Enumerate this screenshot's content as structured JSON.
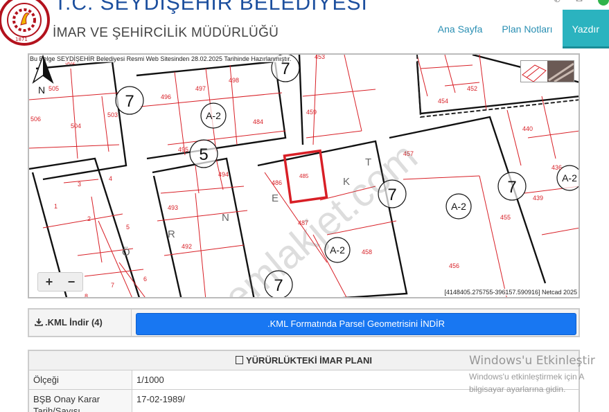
{
  "header": {
    "title": "T.C. SEYDİŞEHİR BELEDİYESİ",
    "subtitle": "İMAR VE ŞEHİRCİLİK MÜDÜRLÜĞÜ",
    "logo_year": "1871"
  },
  "nav": {
    "items": [
      {
        "label": "Ana Sayfa"
      },
      {
        "label": "Plan Notları"
      },
      {
        "label": "Yazdır"
      }
    ],
    "active_index": 2,
    "accent_color": "#2bb3bf",
    "link_color": "#2a8fb3"
  },
  "map": {
    "caption": "Bu Belge SEYDİŞEHİR Belediyesi Resmi Web Sitesinden 28.02.2025 Tarihinde Hazırlanmıştır.",
    "coords": "[4148405.275755-396157.590916] Netcad 2025",
    "zoom_in": "+",
    "zoom_out": "−",
    "north_label": "N",
    "selected_parcel": "485",
    "parcel_line_color": "#d81f26",
    "watermark": "emlakjet.com",
    "parcels": [
      "502",
      "505",
      "496",
      "497",
      "498",
      "453",
      "452",
      "454",
      "506",
      "504",
      "503",
      "484",
      "459",
      "440",
      "457",
      "495",
      "494",
      "486",
      "485",
      "3",
      "4",
      "1",
      "2",
      "5",
      "493",
      "492",
      "6",
      "7",
      "8",
      "458",
      "456",
      "439",
      "455",
      "436",
      "487"
    ],
    "zone_labels": [
      "7",
      "A-2",
      "5",
      "7",
      "7",
      "A-2",
      "7",
      "A-2",
      "7",
      "A-2"
    ],
    "street_letters": [
      "K",
      "T",
      "E",
      "N",
      "R",
      "Ö"
    ]
  },
  "kml": {
    "label": ".KML İndir",
    "footnote": "(4)",
    "button": ".KML Formatında Parsel Geometrisini İNDİR",
    "button_color": "#1877f2"
  },
  "plan": {
    "heading": "YÜRÜRLÜKTEKİ İMAR PLANI",
    "rows": [
      {
        "key": "Ölçeği",
        "value": "1/1000"
      },
      {
        "key": "BŞB Onay Karar Tarih/Sayısı",
        "value": "17-02-1989/"
      }
    ]
  },
  "os_watermark": {
    "line1": "Windows'u Etkinleştir",
    "line2": "Windows'u etkinleştirmek için A",
    "line3": "bilgisayar ayarlarına gidin."
  }
}
